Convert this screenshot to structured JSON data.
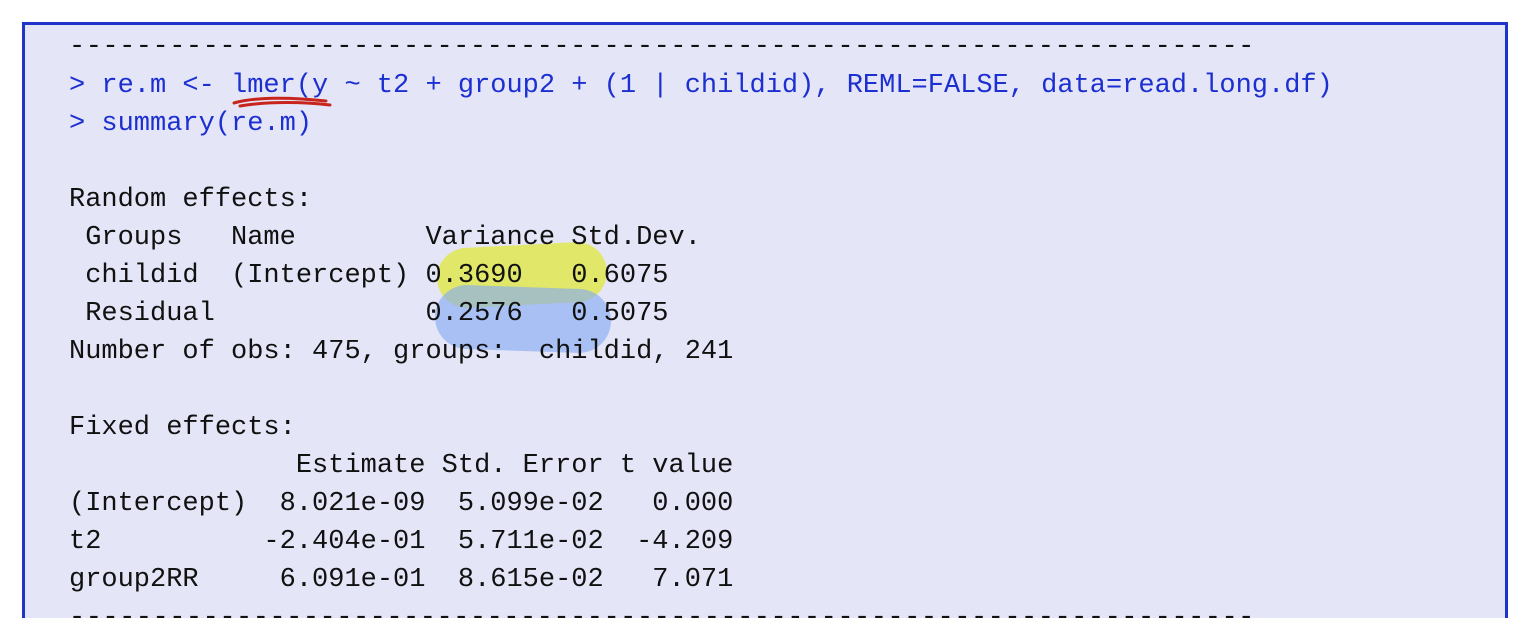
{
  "colors": {
    "border": "#1f35c9",
    "background": "#e5e5f8",
    "command_text": "#1c2fd0",
    "output_text": "#111111",
    "highlight_yellow": "#e1e850",
    "highlight_blue": "#87acf0",
    "pen_red": "#c8241b"
  },
  "console": {
    "rule_top": "-----------------------------------------------------------------------",
    "command1": "> re.m <- lmer(y ~ t2 + group2 + (1 | childid), REML=FALSE, data=read.long.df)",
    "command2": "> summary(re.m)",
    "random_heading": "Random effects:",
    "random_header": " Groups   Name        Variance Std.Dev.",
    "random_row1": " childid  (Intercept) 0.3690   0.6075  ",
    "random_row2": " Residual             0.2576   0.5075  ",
    "obs_line": "Number of obs: 475, groups:  childid, 241",
    "fixed_heading": "Fixed effects:",
    "fixed_header": "              Estimate Std. Error t value",
    "fixed_row1": "(Intercept)  8.021e-09  5.099e-02   0.000",
    "fixed_row2": "t2          -2.404e-01  5.711e-02  -4.209",
    "fixed_row3": "group2RR     6.091e-01  8.615e-02   7.071",
    "rule_bottom": "-----------------------------------------------------------------------"
  }
}
